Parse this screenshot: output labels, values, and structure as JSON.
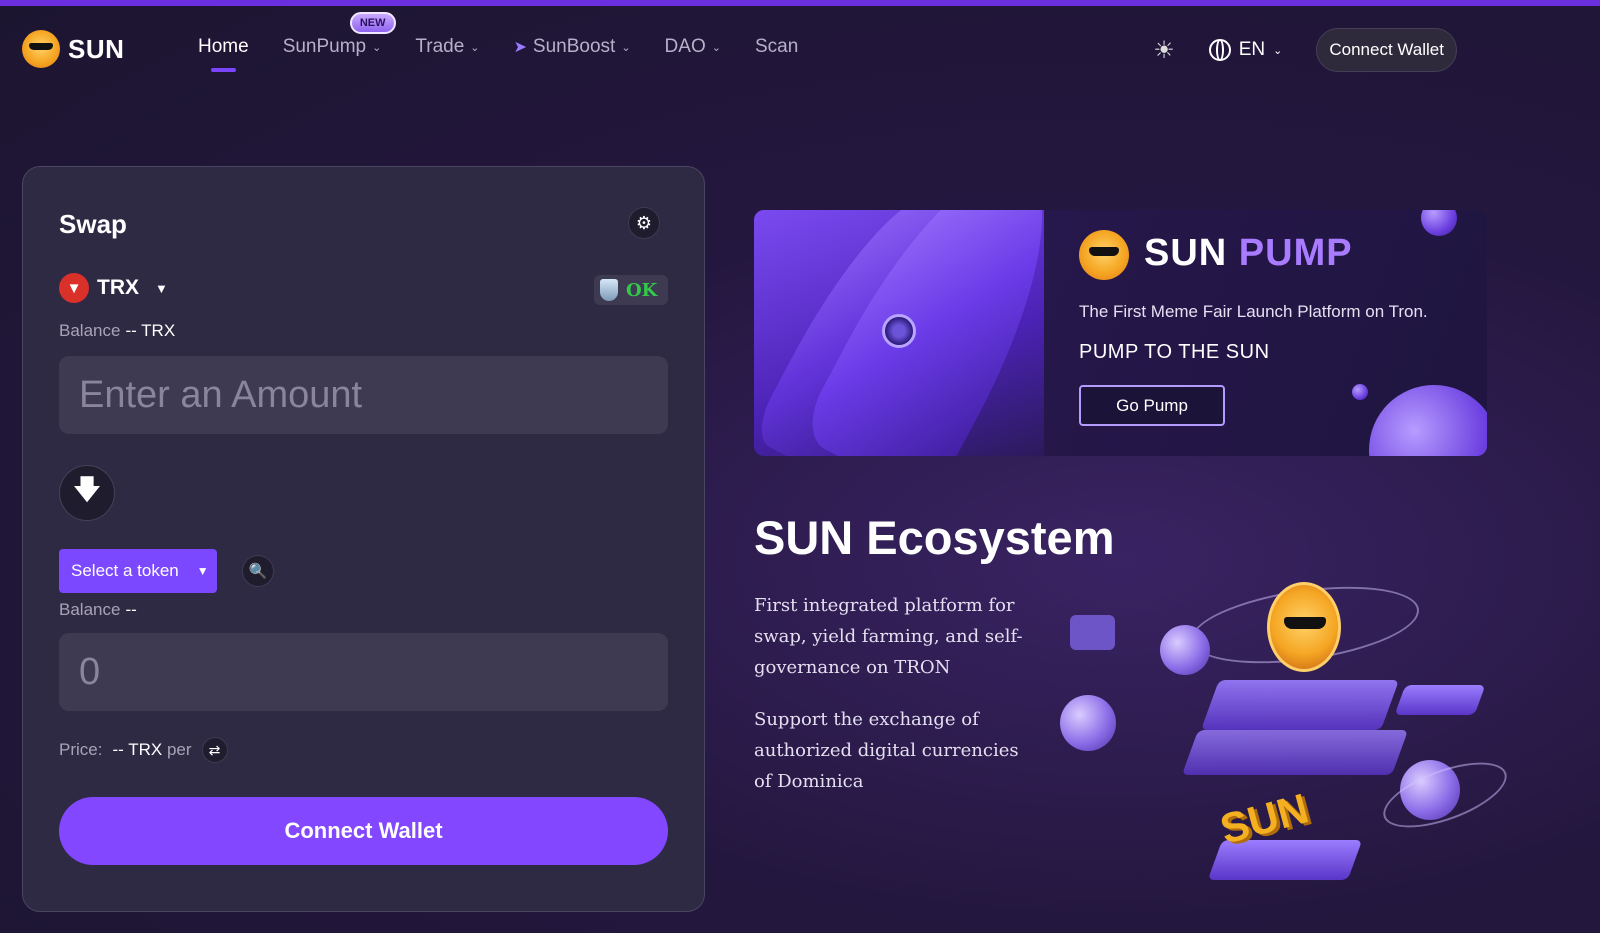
{
  "brand": {
    "name": "SUN"
  },
  "nav": {
    "items": [
      {
        "label": "Home",
        "active": true,
        "dropdown": false
      },
      {
        "label": "SunPump",
        "active": false,
        "dropdown": true,
        "badge": "NEW"
      },
      {
        "label": "Trade",
        "active": false,
        "dropdown": true
      },
      {
        "label": "SunBoost",
        "active": false,
        "dropdown": true,
        "icon": "rocket-icon"
      },
      {
        "label": "DAO",
        "active": false,
        "dropdown": true
      },
      {
        "label": "Scan",
        "active": false,
        "dropdown": false
      }
    ],
    "language": "EN",
    "connect_wallet": "Connect Wallet"
  },
  "swap": {
    "title": "Swap",
    "from_token": "TRX",
    "ok_label": "OK",
    "balance_label": "Balance",
    "from_balance": "-- TRX",
    "amount_placeholder": "Enter an Amount",
    "to_token_button": "Select a token",
    "to_balance": "--",
    "to_amount_placeholder": "0",
    "price_label": "Price:",
    "price_value": "-- TRX",
    "price_per": "per",
    "connect_button": "Connect Wallet"
  },
  "banner": {
    "title_word1": "SUN",
    "title_word2": "PUMP",
    "subtitle": "The First Meme Fair Launch Platform on Tron.",
    "tagline": "PUMP TO THE SUN",
    "cta": "Go Pump"
  },
  "ecosystem": {
    "title": "SUN Ecosystem",
    "paragraph1": "First integrated platform for swap, yield farming, and self-governance on TRON",
    "paragraph2": "Support the exchange of authorized digital currencies of Dominica",
    "illustration_text": "SUN"
  },
  "colors": {
    "accent": "#8247ff",
    "background": "#24173f",
    "card": "#2e2a43",
    "ok_green": "#32c94a"
  }
}
